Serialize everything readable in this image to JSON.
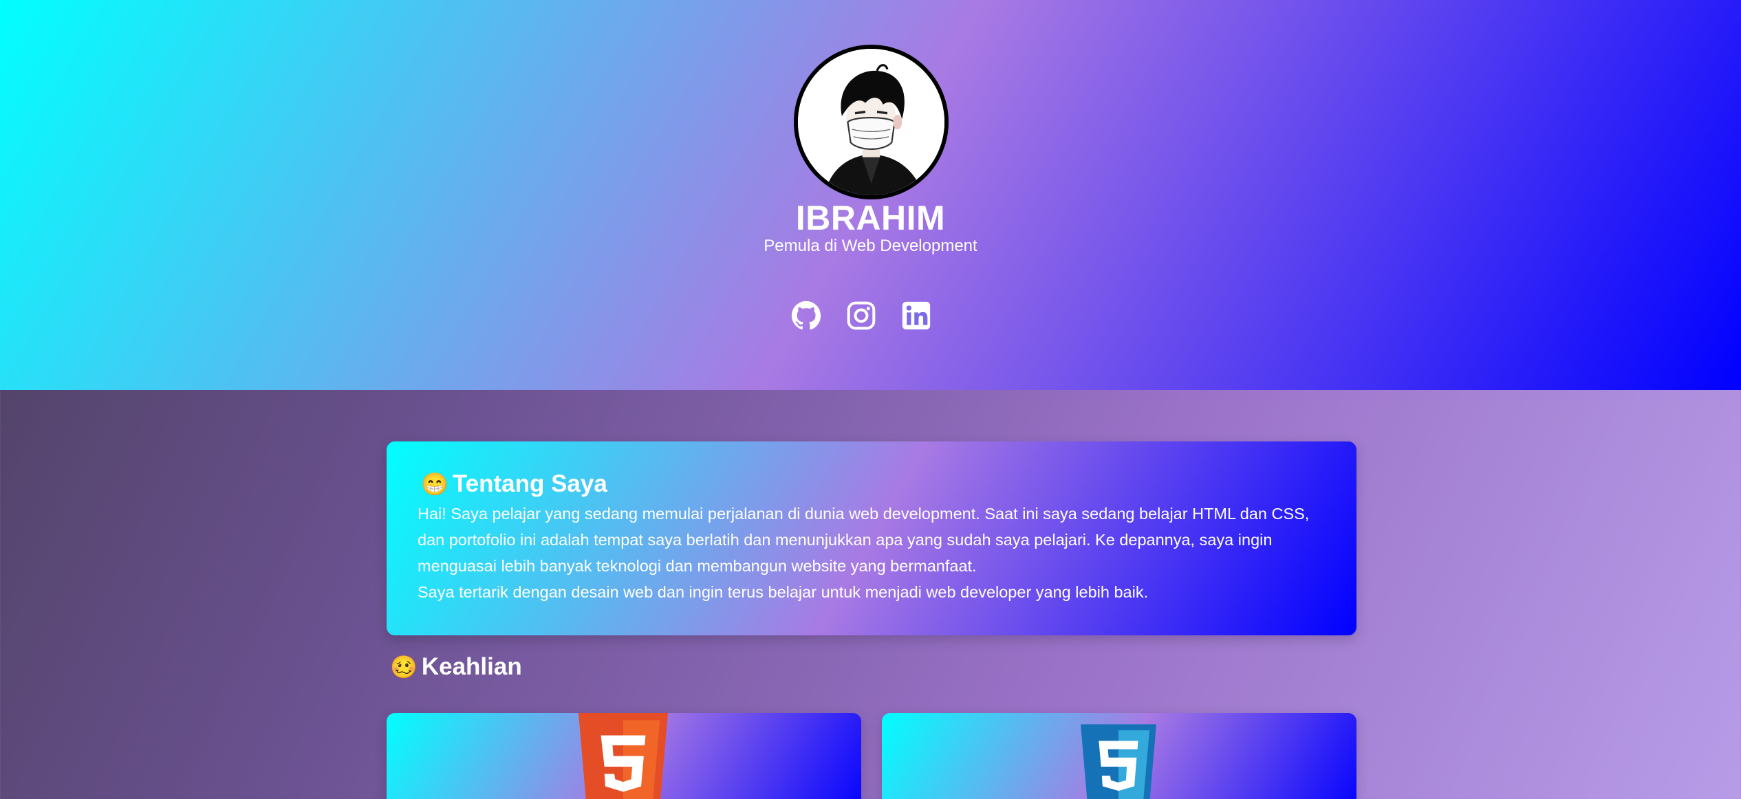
{
  "profile": {
    "name": "IBRAHIM",
    "subtitle": "Pemula di Web Development",
    "avatar_icon": "anime-avatar-icon"
  },
  "socials": [
    {
      "icon": "github-icon"
    },
    {
      "icon": "instagram-icon"
    },
    {
      "icon": "linkedin-icon"
    }
  ],
  "about": {
    "emoji": "😁",
    "title": "Tentang Saya",
    "paragraph1": "Hai! Saya pelajar yang sedang memulai perjalanan di dunia web development. Saat ini saya sedang belajar HTML dan CSS, dan portofolio ini adalah tempat saya berlatih dan menunjukkan apa yang sudah saya pelajari. Ke depannya, saya ingin menguasai lebih banyak teknologi dan membangun website yang bermanfaat.",
    "paragraph2": "Saya tertarik dengan desain web dan ingin terus belajar untuk menjadi web developer yang lebih baik."
  },
  "skills": {
    "emoji": "🥴",
    "title": "Keahlian",
    "items": [
      {
        "icon": "html5-icon",
        "color": "#e44d26"
      },
      {
        "icon": "css3-icon",
        "color": "#1572b6"
      }
    ]
  },
  "colors": {
    "gradient_start": "#00ffff",
    "gradient_mid": "#a87ae3",
    "gradient_end": "#0000ff"
  }
}
